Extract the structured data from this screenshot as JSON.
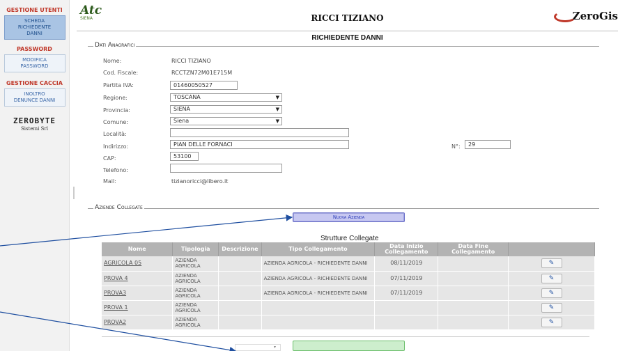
{
  "sidebar": {
    "gestione_utenti": "GESTIONE UTENTI",
    "scheda_richiedente": [
      "SCHEDA",
      "RICHIEDENTE",
      "DANNI"
    ],
    "password_title": "PASSWORD",
    "modifica_password": [
      "MODIFICA",
      "PASSWORD"
    ],
    "gestione_caccia": "GESTIONE CACCIA",
    "inoltro_denunce": [
      "INOLTRO",
      "DENUNCE DANNI"
    ],
    "zerobyte_sub": "Sistemi Srl"
  },
  "header": {
    "logo_atc": "Atc",
    "logo_atc_sub": "SIENA",
    "title": "RICCI TIZIANO",
    "brand": "ZeroGis",
    "subtitle": "RICHIEDENTE DANNI"
  },
  "dati": {
    "legend": "Dati Anagrafici",
    "nome_label": "Nome:",
    "nome": "RICCI TIZIANO",
    "cf_label": "Cod. Fiscale:",
    "cf": "RCCTZN72M01E715M",
    "piva_label": "Partita IVA:",
    "piva": "01460050527",
    "regione_label": "Regione:",
    "regione": "TOSCANA",
    "provincia_label": "Provincia:",
    "provincia": "SIENA",
    "comune_label": "Comune:",
    "comune": "Siena",
    "localita_label": "Località:",
    "localita": "",
    "indirizzo_label": "Indirizzo:",
    "indirizzo": "PIAN DELLE FORNACI",
    "numero_label": "N°:",
    "numero": "29",
    "cap_label": "CAP:",
    "cap": "53100",
    "telefono_label": "Telefono:",
    "telefono": "",
    "mail_label": "Mail:",
    "mail": "tizianoricci@libero.it"
  },
  "aziende": {
    "legend": "Aziende Collegate",
    "nuova_button": "Nuova Azienda",
    "table_title": "Strutture Collegate",
    "columns": [
      "Nome",
      "Tipologia",
      "Descrizione",
      "Tipo Collegamento",
      "Data Inizio Collegamento",
      "Data Fine Collegamento",
      ""
    ],
    "rows": [
      {
        "nome": "AGRICOLA 05",
        "tipologia": "AZIENDA AGRICOLA",
        "descrizione": "",
        "tipo": "AZIENDA AGRICOLA - RICHIEDENTE DANNI",
        "inizio": "08/11/2019",
        "fine": ""
      },
      {
        "nome": "PROVA 4",
        "tipologia": "AZIENDA AGRICOLA",
        "descrizione": "",
        "tipo": "AZIENDA AGRICOLA - RICHIEDENTE DANNI",
        "inizio": "07/11/2019",
        "fine": ""
      },
      {
        "nome": "PROVA3",
        "tipologia": "AZIENDA AGRICOLA",
        "descrizione": "",
        "tipo": "AZIENDA AGRICOLA - RICHIEDENTE DANNI",
        "inizio": "07/11/2019",
        "fine": ""
      },
      {
        "nome": "PROVA 1",
        "tipologia": "AZIENDA AGRICOLA",
        "descrizione": "",
        "tipo": "",
        "inizio": "",
        "fine": ""
      },
      {
        "nome": "PROVA2",
        "tipologia": "AZIENDA AGRICOLA",
        "descrizione": "",
        "tipo": "",
        "inizio": "",
        "fine": ""
      }
    ]
  },
  "icons": {
    "edit": "pencil-icon",
    "dropdown": "chevron-down-icon"
  },
  "colors": {
    "sidebar_title": "#c0392b",
    "active_button": "#a9c4e4",
    "table_header": "#b3b3b3",
    "nuova_button": "#c7c8f1"
  }
}
